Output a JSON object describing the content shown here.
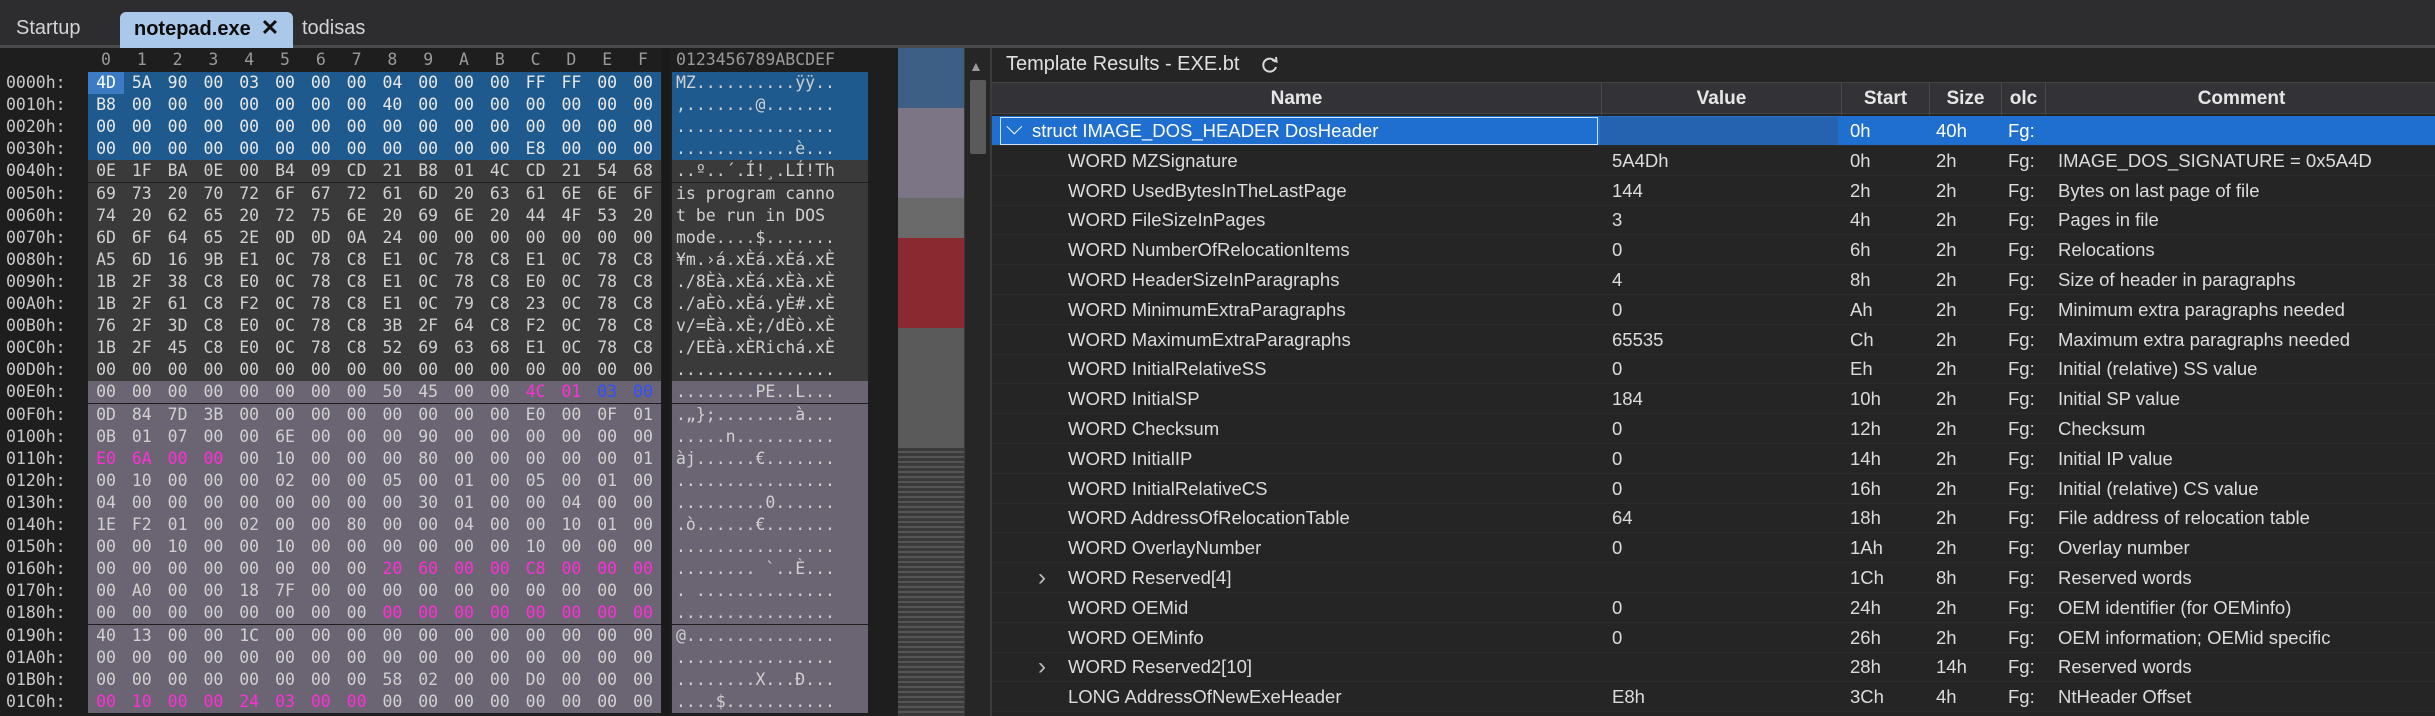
{
  "tabs": [
    {
      "label": "Startup"
    },
    {
      "label": "notepad.exe",
      "close": "✕"
    },
    {
      "label": "todisas"
    }
  ],
  "hex": {
    "column_header": [
      "0",
      "1",
      "2",
      "3",
      "4",
      "5",
      "6",
      "7",
      "8",
      "9",
      "A",
      "B",
      "C",
      "D",
      "E",
      "F"
    ],
    "ascii_header": "0123456789ABCDEF",
    "rows": [
      {
        "addr": "0000h:",
        "bytes": [
          "4D",
          "5A",
          "90",
          "00",
          "03",
          "00",
          "00",
          "00",
          "04",
          "00",
          "00",
          "00",
          "FF",
          "FF",
          "00",
          "00"
        ],
        "ascii": "MZ..........ÿÿ.."
      },
      {
        "addr": "0010h:",
        "bytes": [
          "B8",
          "00",
          "00",
          "00",
          "00",
          "00",
          "00",
          "00",
          "40",
          "00",
          "00",
          "00",
          "00",
          "00",
          "00",
          "00"
        ],
        "ascii": ",.......@......."
      },
      {
        "addr": "0020h:",
        "bytes": [
          "00",
          "00",
          "00",
          "00",
          "00",
          "00",
          "00",
          "00",
          "00",
          "00",
          "00",
          "00",
          "00",
          "00",
          "00",
          "00"
        ],
        "ascii": "................"
      },
      {
        "addr": "0030h:",
        "bytes": [
          "00",
          "00",
          "00",
          "00",
          "00",
          "00",
          "00",
          "00",
          "00",
          "00",
          "00",
          "00",
          "E8",
          "00",
          "00",
          "00"
        ],
        "ascii": "............è..."
      },
      {
        "addr": "0040h:",
        "bytes": [
          "0E",
          "1F",
          "BA",
          "0E",
          "00",
          "B4",
          "09",
          "CD",
          "21",
          "B8",
          "01",
          "4C",
          "CD",
          "21",
          "54",
          "68"
        ],
        "ascii": "..º..´.Í!¸.LÍ!Th"
      },
      {
        "addr": "0050h:",
        "bytes": [
          "69",
          "73",
          "20",
          "70",
          "72",
          "6F",
          "67",
          "72",
          "61",
          "6D",
          "20",
          "63",
          "61",
          "6E",
          "6E",
          "6F"
        ],
        "ascii": "is program canno"
      },
      {
        "addr": "0060h:",
        "bytes": [
          "74",
          "20",
          "62",
          "65",
          "20",
          "72",
          "75",
          "6E",
          "20",
          "69",
          "6E",
          "20",
          "44",
          "4F",
          "53",
          "20"
        ],
        "ascii": "t be run in DOS "
      },
      {
        "addr": "0070h:",
        "bytes": [
          "6D",
          "6F",
          "64",
          "65",
          "2E",
          "0D",
          "0D",
          "0A",
          "24",
          "00",
          "00",
          "00",
          "00",
          "00",
          "00",
          "00"
        ],
        "ascii": "mode....$......."
      },
      {
        "addr": "0080h:",
        "bytes": [
          "A5",
          "6D",
          "16",
          "9B",
          "E1",
          "0C",
          "78",
          "C8",
          "E1",
          "0C",
          "78",
          "C8",
          "E1",
          "0C",
          "78",
          "C8"
        ],
        "ascii": "¥m.›á.xÈá.xÈá.xÈ"
      },
      {
        "addr": "0090h:",
        "bytes": [
          "1B",
          "2F",
          "38",
          "C8",
          "E0",
          "0C",
          "78",
          "C8",
          "E1",
          "0C",
          "78",
          "C8",
          "E0",
          "0C",
          "78",
          "C8"
        ],
        "ascii": "./8Èà.xÈá.xÈà.xÈ"
      },
      {
        "addr": "00A0h:",
        "bytes": [
          "1B",
          "2F",
          "61",
          "C8",
          "F2",
          "0C",
          "78",
          "C8",
          "E1",
          "0C",
          "79",
          "C8",
          "23",
          "0C",
          "78",
          "C8"
        ],
        "ascii": "./aÈò.xÈá.yÈ#.xÈ"
      },
      {
        "addr": "00B0h:",
        "bytes": [
          "76",
          "2F",
          "3D",
          "C8",
          "E0",
          "0C",
          "78",
          "C8",
          "3B",
          "2F",
          "64",
          "C8",
          "F2",
          "0C",
          "78",
          "C8"
        ],
        "ascii": "v/=Èà.xÈ;/dÈò.xÈ"
      },
      {
        "addr": "00C0h:",
        "bytes": [
          "1B",
          "2F",
          "45",
          "C8",
          "E0",
          "0C",
          "78",
          "C8",
          "52",
          "69",
          "63",
          "68",
          "E1",
          "0C",
          "78",
          "C8"
        ],
        "ascii": "./EÈà.xÈRichá.xÈ"
      },
      {
        "addr": "00D0h:",
        "bytes": [
          "00",
          "00",
          "00",
          "00",
          "00",
          "00",
          "00",
          "00",
          "00",
          "00",
          "00",
          "00",
          "00",
          "00",
          "00",
          "00"
        ],
        "ascii": "................"
      },
      {
        "addr": "00E0h:",
        "bytes": [
          "00",
          "00",
          "00",
          "00",
          "00",
          "00",
          "00",
          "00",
          "50",
          "45",
          "00",
          "00",
          "4C",
          "01",
          "03",
          "00"
        ],
        "ascii": "........PE..L..."
      },
      {
        "addr": "00F0h:",
        "bytes": [
          "0D",
          "84",
          "7D",
          "3B",
          "00",
          "00",
          "00",
          "00",
          "00",
          "00",
          "00",
          "00",
          "E0",
          "00",
          "0F",
          "01"
        ],
        "ascii": ".„};........à..."
      },
      {
        "addr": "0100h:",
        "bytes": [
          "0B",
          "01",
          "07",
          "00",
          "00",
          "6E",
          "00",
          "00",
          "00",
          "90",
          "00",
          "00",
          "00",
          "00",
          "00",
          "00"
        ],
        "ascii": ".....n.........."
      },
      {
        "addr": "0110h:",
        "bytes": [
          "E0",
          "6A",
          "00",
          "00",
          "00",
          "10",
          "00",
          "00",
          "00",
          "80",
          "00",
          "00",
          "00",
          "00",
          "00",
          "01"
        ],
        "ascii": "àj......€......."
      },
      {
        "addr": "0120h:",
        "bytes": [
          "00",
          "10",
          "00",
          "00",
          "00",
          "02",
          "00",
          "00",
          "05",
          "00",
          "01",
          "00",
          "05",
          "00",
          "01",
          "00"
        ],
        "ascii": "................"
      },
      {
        "addr": "0130h:",
        "bytes": [
          "04",
          "00",
          "00",
          "00",
          "00",
          "00",
          "00",
          "00",
          "00",
          "30",
          "01",
          "00",
          "00",
          "04",
          "00",
          "00"
        ],
        "ascii": ".........0......"
      },
      {
        "addr": "0140h:",
        "bytes": [
          "1E",
          "F2",
          "01",
          "00",
          "02",
          "00",
          "00",
          "80",
          "00",
          "00",
          "04",
          "00",
          "00",
          "10",
          "01",
          "00"
        ],
        "ascii": ".ò......€......."
      },
      {
        "addr": "0150h:",
        "bytes": [
          "00",
          "00",
          "10",
          "00",
          "00",
          "10",
          "00",
          "00",
          "00",
          "00",
          "00",
          "00",
          "10",
          "00",
          "00",
          "00"
        ],
        "ascii": "................"
      },
      {
        "addr": "0160h:",
        "bytes": [
          "00",
          "00",
          "00",
          "00",
          "00",
          "00",
          "00",
          "00",
          "20",
          "60",
          "00",
          "00",
          "C8",
          "00",
          "00",
          "00"
        ],
        "ascii": "........ `..È..."
      },
      {
        "addr": "0170h:",
        "bytes": [
          "00",
          "A0",
          "00",
          "00",
          "18",
          "7F",
          "00",
          "00",
          "00",
          "00",
          "00",
          "00",
          "00",
          "00",
          "00",
          "00"
        ],
        "ascii": ". .............."
      },
      {
        "addr": "0180h:",
        "bytes": [
          "00",
          "00",
          "00",
          "00",
          "00",
          "00",
          "00",
          "00",
          "00",
          "00",
          "00",
          "00",
          "00",
          "00",
          "00",
          "00"
        ],
        "ascii": "................"
      },
      {
        "addr": "0190h:",
        "bytes": [
          "40",
          "13",
          "00",
          "00",
          "1C",
          "00",
          "00",
          "00",
          "00",
          "00",
          "00",
          "00",
          "00",
          "00",
          "00",
          "00"
        ],
        "ascii": "@..............."
      },
      {
        "addr": "01A0h:",
        "bytes": [
          "00",
          "00",
          "00",
          "00",
          "00",
          "00",
          "00",
          "00",
          "00",
          "00",
          "00",
          "00",
          "00",
          "00",
          "00",
          "00"
        ],
        "ascii": "................"
      },
      {
        "addr": "01B0h:",
        "bytes": [
          "00",
          "00",
          "00",
          "00",
          "00",
          "00",
          "00",
          "00",
          "58",
          "02",
          "00",
          "00",
          "D0",
          "00",
          "00",
          "00"
        ],
        "ascii": "........X...Ð..."
      },
      {
        "addr": "01C0h:",
        "bytes": [
          "00",
          "10",
          "00",
          "00",
          "24",
          "03",
          "00",
          "00",
          "00",
          "00",
          "00",
          "00",
          "00",
          "00",
          "00",
          "00"
        ],
        "ascii": "....$..........."
      }
    ]
  },
  "template": {
    "title": "Template Results - EXE.bt",
    "refresh_icon": "refresh-icon",
    "columns": [
      "Name",
      "Value",
      "Start",
      "Size",
      "olc",
      "Comment"
    ],
    "rows": [
      {
        "name": "struct IMAGE_DOS_HEADER DosHeader",
        "value": "",
        "start": "0h",
        "size": "40h",
        "fg": "Fg:",
        "comment": "",
        "expanded": true,
        "selected": true,
        "indent": 0
      },
      {
        "name": "WORD MZSignature",
        "value": "5A4Dh",
        "start": "0h",
        "size": "2h",
        "fg": "Fg:",
        "comment": "IMAGE_DOS_SIGNATURE = 0x5A4D",
        "indent": 1
      },
      {
        "name": "WORD UsedBytesInTheLastPage",
        "value": "144",
        "start": "2h",
        "size": "2h",
        "fg": "Fg:",
        "comment": "Bytes on last page of file",
        "indent": 1
      },
      {
        "name": "WORD FileSizeInPages",
        "value": "3",
        "start": "4h",
        "size": "2h",
        "fg": "Fg:",
        "comment": "Pages in file",
        "indent": 1
      },
      {
        "name": "WORD NumberOfRelocationItems",
        "value": "0",
        "start": "6h",
        "size": "2h",
        "fg": "Fg:",
        "comment": "Relocations",
        "indent": 1
      },
      {
        "name": "WORD HeaderSizeInParagraphs",
        "value": "4",
        "start": "8h",
        "size": "2h",
        "fg": "Fg:",
        "comment": "Size of header in paragraphs",
        "indent": 1
      },
      {
        "name": "WORD MinimumExtraParagraphs",
        "value": "0",
        "start": "Ah",
        "size": "2h",
        "fg": "Fg:",
        "comment": "Minimum extra paragraphs needed",
        "indent": 1
      },
      {
        "name": "WORD MaximumExtraParagraphs",
        "value": "65535",
        "start": "Ch",
        "size": "2h",
        "fg": "Fg:",
        "comment": "Maximum extra paragraphs needed",
        "indent": 1
      },
      {
        "name": "WORD InitialRelativeSS",
        "value": "0",
        "start": "Eh",
        "size": "2h",
        "fg": "Fg:",
        "comment": "Initial (relative) SS value",
        "indent": 1
      },
      {
        "name": "WORD InitialSP",
        "value": "184",
        "start": "10h",
        "size": "2h",
        "fg": "Fg:",
        "comment": "Initial SP value",
        "indent": 1
      },
      {
        "name": "WORD Checksum",
        "value": "0",
        "start": "12h",
        "size": "2h",
        "fg": "Fg:",
        "comment": "Checksum",
        "indent": 1
      },
      {
        "name": "WORD InitialIP",
        "value": "0",
        "start": "14h",
        "size": "2h",
        "fg": "Fg:",
        "comment": "Initial IP value",
        "indent": 1
      },
      {
        "name": "WORD InitialRelativeCS",
        "value": "0",
        "start": "16h",
        "size": "2h",
        "fg": "Fg:",
        "comment": "Initial (relative) CS value",
        "indent": 1
      },
      {
        "name": "WORD AddressOfRelocationTable",
        "value": "64",
        "start": "18h",
        "size": "2h",
        "fg": "Fg:",
        "comment": "File address of relocation table",
        "indent": 1
      },
      {
        "name": "WORD OverlayNumber",
        "value": "0",
        "start": "1Ah",
        "size": "2h",
        "fg": "Fg:",
        "comment": "Overlay number",
        "indent": 1
      },
      {
        "name": "WORD Reserved[4]",
        "value": "",
        "start": "1Ch",
        "size": "8h",
        "fg": "Fg:",
        "comment": "Reserved words",
        "collapsed": true,
        "indent": 1
      },
      {
        "name": "WORD OEMid",
        "value": "0",
        "start": "24h",
        "size": "2h",
        "fg": "Fg:",
        "comment": "OEM identifier (for OEMinfo)",
        "indent": 1
      },
      {
        "name": "WORD OEMinfo",
        "value": "0",
        "start": "26h",
        "size": "2h",
        "fg": "Fg:",
        "comment": "OEM information; OEMid specific",
        "indent": 1
      },
      {
        "name": "WORD Reserved2[10]",
        "value": "",
        "start": "28h",
        "size": "14h",
        "fg": "Fg:",
        "comment": "Reserved words",
        "collapsed": true,
        "indent": 1
      },
      {
        "name": "LONG AddressOfNewExeHeader",
        "value": "E8h",
        "start": "3Ch",
        "size": "4h",
        "fg": "Fg:",
        "comment": "NtHeader Offset",
        "indent": 1
      }
    ]
  },
  "colors": {
    "selection": "#1f6fd0",
    "header_highlight": "#1f5a8f",
    "magenta_bytes": "#ff2fd8",
    "blue_bytes": "#3050ff",
    "purple_region": "#6b6573"
  }
}
